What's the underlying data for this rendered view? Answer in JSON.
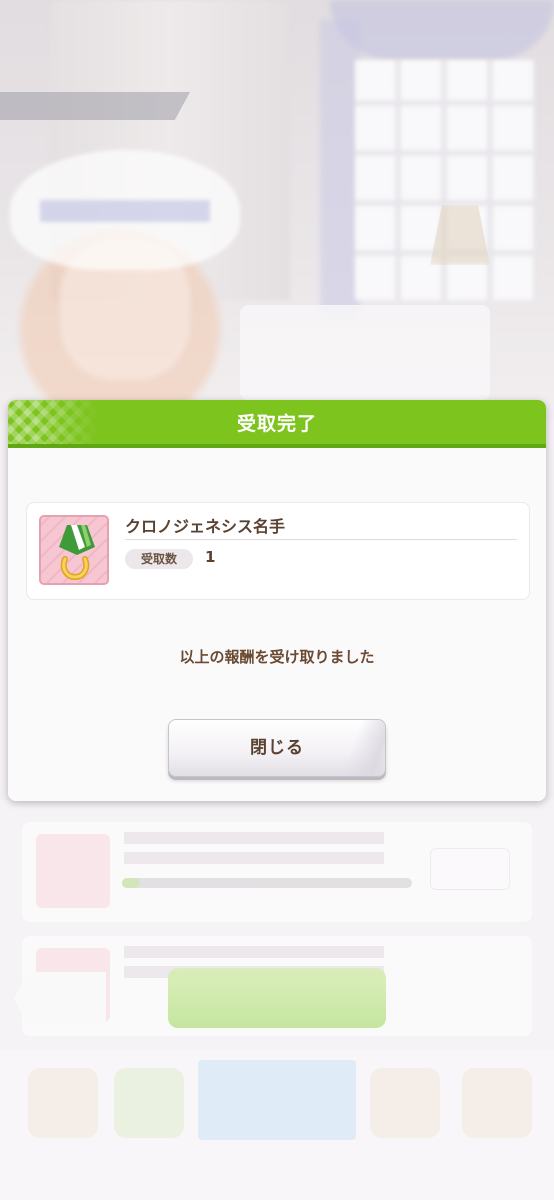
{
  "dialog": {
    "title": "受取完了",
    "reward": {
      "name": "クロノジェネシス名手",
      "qty_label": "受取数",
      "qty_value": "1"
    },
    "message": "以上の報酬を受け取りました",
    "close_label": "閉じる"
  },
  "colors": {
    "header_green": "#7dc41f",
    "text_brown": "#5a4130",
    "icon_pink": "#f6c7d2"
  },
  "icons": {
    "reward_icon": "medal-ribbon-horseshoe-icon"
  }
}
